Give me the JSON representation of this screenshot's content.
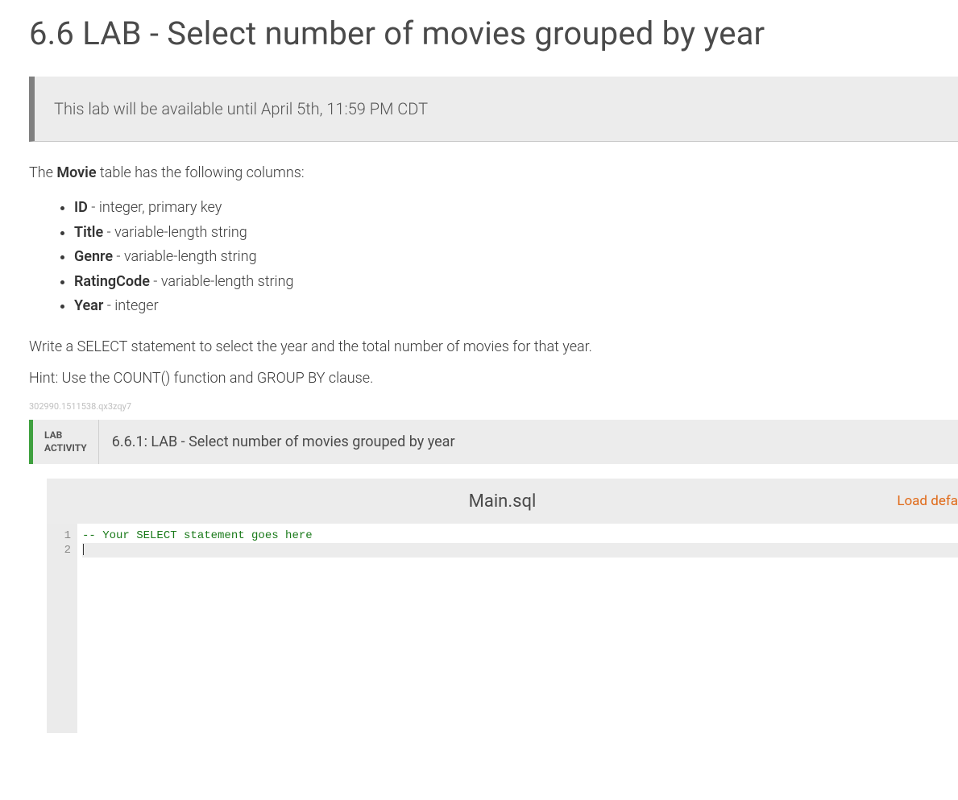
{
  "page": {
    "title": "6.6 LAB - Select number of movies grouped by year"
  },
  "notice": {
    "text": "This lab will be available until April 5th, 11:59 PM CDT"
  },
  "intro": {
    "prefix": "The ",
    "table_name": "Movie",
    "suffix": " table has the following columns:"
  },
  "columns": [
    {
      "name": "ID",
      "desc": " - integer, primary key"
    },
    {
      "name": "Title",
      "desc": " - variable-length string"
    },
    {
      "name": "Genre",
      "desc": " - variable-length string"
    },
    {
      "name": "RatingCode",
      "desc": " - variable-length string"
    },
    {
      "name": "Year",
      "desc": " - integer"
    }
  ],
  "task": "Write a SELECT statement to select the year and the total number of movies for that year.",
  "hint": "Hint: Use the COUNT() function and GROUP BY clause.",
  "small_id": "302990.1511538.qx3zqy7",
  "activity": {
    "label_line1": "LAB",
    "label_line2": "ACTIVITY",
    "title": "6.6.1: LAB - Select number of movies grouped by year"
  },
  "editor": {
    "filename": "Main.sql",
    "load_link": "Load defa",
    "lines": [
      {
        "num": "1",
        "text": "-- Your SELECT statement goes here",
        "is_comment": true
      },
      {
        "num": "2",
        "text": "",
        "is_comment": false
      }
    ]
  }
}
